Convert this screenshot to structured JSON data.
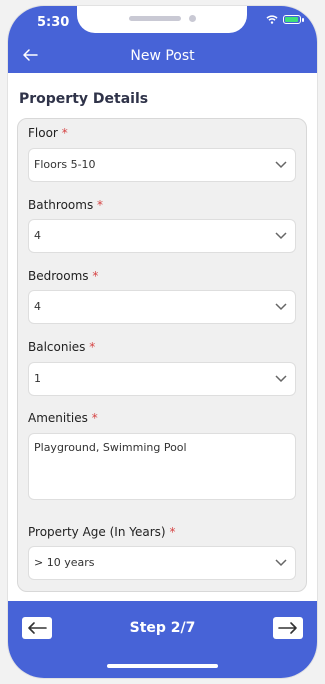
{
  "status_bar": {
    "time": "5:30"
  },
  "header": {
    "title": "New Post"
  },
  "section": {
    "title": "Property Details"
  },
  "form": {
    "floor": {
      "label": "Floor",
      "required": "*",
      "value": "Floors 5-10"
    },
    "bathrooms": {
      "label": "Bathrooms",
      "required": "*",
      "value": "4"
    },
    "bedrooms": {
      "label": "Bedrooms",
      "required": "*",
      "value": "4"
    },
    "balconies": {
      "label": "Balconies",
      "required": "*",
      "value": "1"
    },
    "amenities": {
      "label": "Amenities",
      "required": "*",
      "value": "Playground, Swimming Pool"
    },
    "property_age": {
      "label": "Property Age (In Years)",
      "required": "*",
      "value": "> 10 years"
    }
  },
  "footer": {
    "step": "Step 2/7"
  },
  "colors": {
    "primary": "#4763d7",
    "required": "#d64343"
  }
}
